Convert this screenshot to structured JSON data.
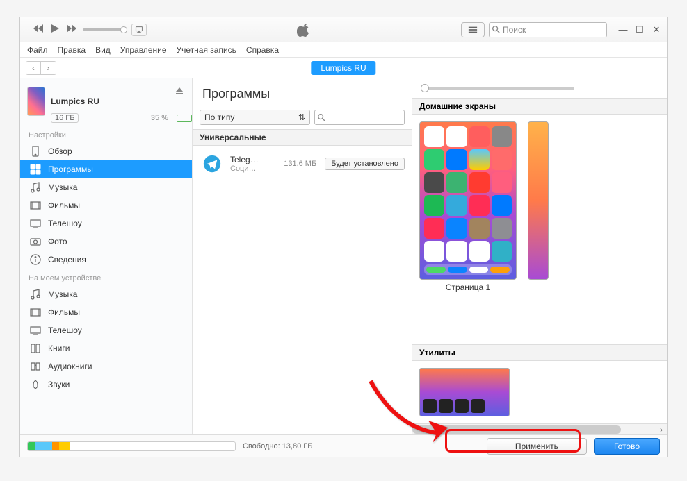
{
  "menubar": [
    "Файл",
    "Правка",
    "Вид",
    "Управление",
    "Учетная запись",
    "Справка"
  ],
  "search_placeholder": "Поиск",
  "nav_pill": "Lumpics RU",
  "device": {
    "name": "Lumpics RU",
    "capacity": "16 ГБ",
    "battery_pct": "35 %"
  },
  "sidebar": {
    "settings_header": "Настройки",
    "settings_items": [
      "Обзор",
      "Программы",
      "Музыка",
      "Фильмы",
      "Телешоу",
      "Фото",
      "Сведения"
    ],
    "device_header": "На моем устройстве",
    "device_items": [
      "Музыка",
      "Фильмы",
      "Телешоу",
      "Книги",
      "Аудиокниги",
      "Звуки"
    ]
  },
  "apps": {
    "title": "Программы",
    "sort_label": "По типу",
    "section_universal": "Универсальные",
    "app_name": "Teleg…",
    "app_category": "Соци…",
    "app_size": "131,6 МБ",
    "install_state": "Будет установлено"
  },
  "screens": {
    "home_label": "Домашние экраны",
    "page1_label": "Страница 1",
    "utilities_label": "Утилиты"
  },
  "bottom": {
    "free_label": "Свободно: 13,80 ГБ",
    "apply": "Применить",
    "done": "Готово"
  }
}
